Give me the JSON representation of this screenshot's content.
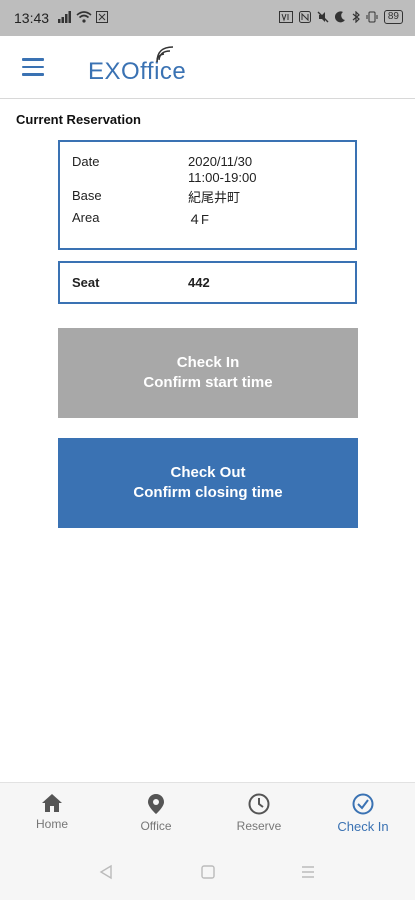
{
  "status": {
    "time": "13:43",
    "battery": "89"
  },
  "header": {
    "logo": "EXOffice"
  },
  "reservation": {
    "title": "Current Reservation",
    "date_label": "Date",
    "date_value": "2020/11/30",
    "time_value": "11:00-19:00",
    "base_label": "Base",
    "base_value": "紀尾井町",
    "area_label": "Area",
    "area_value": "４F",
    "seat_label": "Seat",
    "seat_value": "442"
  },
  "actions": {
    "checkin_line1": "Check In",
    "checkin_line2": "Confirm start time",
    "checkout_line1": "Check Out",
    "checkout_line2": "Confirm closing time",
    "checkin_color": "#a8a8a8",
    "checkout_color": "#3a72b3"
  },
  "bottom_nav": {
    "items": [
      {
        "label": "Home",
        "icon": "home-icon"
      },
      {
        "label": "Office",
        "icon": "location-pin-icon"
      },
      {
        "label": "Reserve",
        "icon": "clock-icon"
      },
      {
        "label": "Check In",
        "icon": "check-circle-icon",
        "active": true
      }
    ]
  },
  "colors": {
    "accent": "#3a72b3",
    "status_bar": "#bdbdbd"
  }
}
